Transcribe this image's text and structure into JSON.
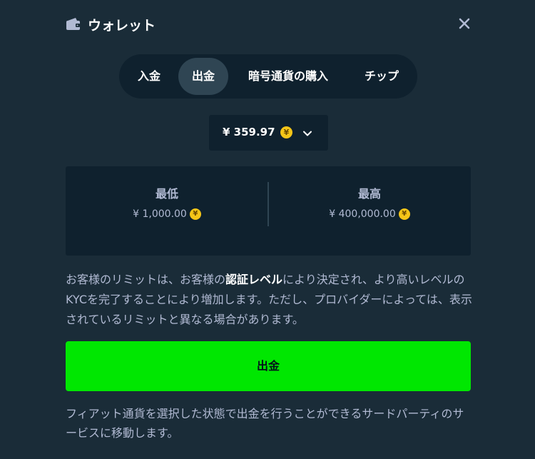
{
  "header": {
    "title": "ウォレット",
    "wallet_icon": "wallet-icon",
    "close_icon": "close-icon"
  },
  "tabs": [
    {
      "label": "入金",
      "active": false
    },
    {
      "label": "出金",
      "active": true
    },
    {
      "label": "暗号通貨の購入",
      "active": false
    },
    {
      "label": "チップ",
      "active": false
    }
  ],
  "currency": {
    "amount": "¥ 359.97",
    "coin_symbol": "¥",
    "chevron_icon": "chevron-down-icon"
  },
  "limits": {
    "min": {
      "label": "最低",
      "value": "¥ 1,000.00"
    },
    "max": {
      "label": "最高",
      "value": "¥ 400,000.00"
    }
  },
  "info": {
    "part1": "お客様のリミットは、お客様の",
    "link": "認証レベル",
    "part2": "により決定され、より高いレベルのKYCを完了することにより増加します。ただし、プロバイダーによっては、表示されているリミットと異なる場合があります。"
  },
  "withdraw_button": {
    "label": "出金"
  },
  "note": "フィアット通貨を選択した状態で出金を行うことができるサードパーティのサービスに移動します。",
  "colors": {
    "background": "#1a2c38",
    "panel": "#0f212e",
    "active_tab": "#2f4553",
    "primary": "#00e701",
    "muted_text": "#b1bad3",
    "coin": "#f5c518"
  }
}
